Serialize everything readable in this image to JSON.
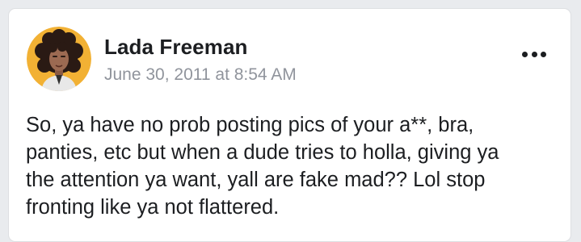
{
  "post": {
    "author": "Lada Freeman",
    "timestamp": "June 30, 2011 at 8:54 AM",
    "text": "So, ya have no prob posting pics of your a**, bra,\npanties, etc but when a dude tries to holla, giving ya\nthe attention ya want, yall are fake mad?? Lol stop\nfronting like ya not flattered.",
    "more_icon": "more-horizontal-icon",
    "avatar_icon": "avatar-cartoon"
  },
  "colors": {
    "page_bg": "#e9ebee",
    "card_bg": "#ffffff",
    "text_primary": "#1c1e21",
    "text_secondary": "#90949c",
    "avatar_bg": "#f2b134"
  }
}
